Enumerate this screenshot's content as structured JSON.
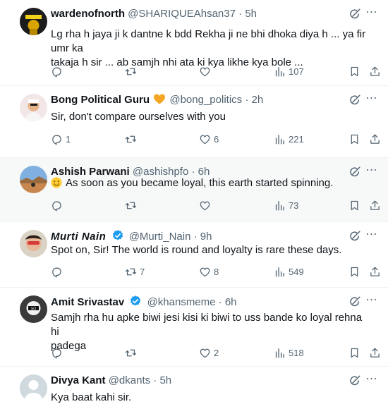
{
  "replies": [
    {
      "name": "wardenofnorth",
      "handle": "@SHARIQUEAhsan37",
      "time": "5h",
      "text_lines": [
        "Lg rha h jaya ji k dantne k bdd Rekha ji ne bhi dhoka diya h ... ya fir umr ka",
        "takaja h sir ... ab samjh nhi ata ki kya likhe kya bole ..."
      ],
      "stats": {
        "replies": "",
        "reposts": "",
        "likes": "",
        "views": "107"
      }
    },
    {
      "name": "Bong Political Guru",
      "handle": "@bong_politics",
      "time": "2h",
      "text_lines": [
        "Sir, don't compare ourselves with you"
      ],
      "stats": {
        "replies": "1",
        "reposts": "",
        "likes": "6",
        "views": "221"
      }
    },
    {
      "name": "Ashish Parwani",
      "handle": "@ashishpfo",
      "time": "6h",
      "text_lines": [
        "As soon as you became loyal, this earth started spinning."
      ],
      "stats": {
        "replies": "",
        "reposts": "",
        "likes": "",
        "views": "73"
      }
    },
    {
      "name": "Murti Nain",
      "handle": "@Murti_Nain",
      "time": "9h",
      "text_lines": [
        "Spot on, Sir! The world is round and loyalty is rare these days."
      ],
      "stats": {
        "replies": "",
        "reposts": "7",
        "likes": "8",
        "views": "549"
      }
    },
    {
      "name": "Amit Srivastav",
      "handle": "@khansmeme",
      "time": "6h",
      "text_lines": [
        "Samjh rha hu apke biwi jesi kisi ki biwi to uss bande ko loyal rehna hi",
        "padega"
      ],
      "stats": {
        "replies": "",
        "reposts": "",
        "likes": "2",
        "views": "518"
      }
    },
    {
      "name": "Divya Kant",
      "handle": "@dkants",
      "time": "5h",
      "text_lines": [
        "Kya baat kahi sir."
      ],
      "stats": {
        "replies": "",
        "reposts": "",
        "likes": "",
        "views": ""
      }
    }
  ],
  "separator": "·",
  "icons": [
    "reply-icon",
    "repost-icon",
    "like-icon",
    "views-icon",
    "bookmark-icon",
    "share-icon",
    "grok-icon",
    "more-icon",
    "verified-icon",
    "heart-emoji",
    "smile-emoji"
  ],
  "colors": {
    "text": "#0f1419",
    "secondary": "#536471",
    "verified": "#1d9bf0",
    "heart_emoji": "#f5a623",
    "highlight_bg": "#f7f9f9"
  }
}
